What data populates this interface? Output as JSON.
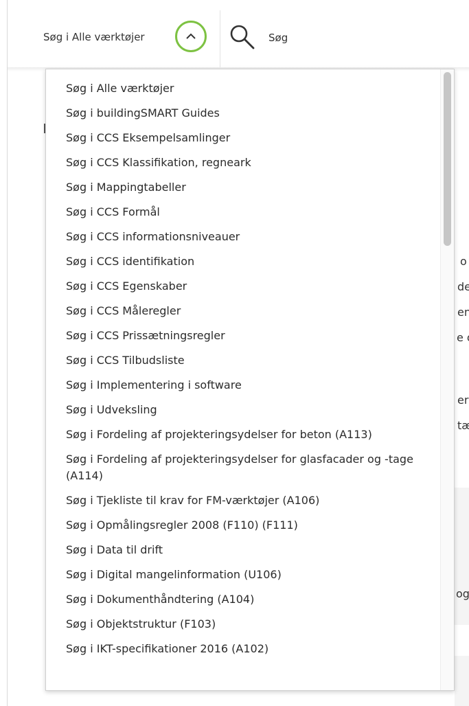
{
  "header": {
    "scope_label": "Søg i Alle værktøjer",
    "search_label": "Søg",
    "accent_color": "#7dc242"
  },
  "background": {
    "fragments": [
      "o",
      "de",
      "en",
      "e o",
      "er",
      "tæ",
      "og"
    ]
  },
  "dropdown": {
    "items": [
      "Søg i Alle værktøjer",
      "Søg i buildingSMART Guides",
      "Søg i CCS Eksempelsamlinger",
      "Søg i CCS Klassifikation, regneark",
      "Søg i Mappingtabeller",
      "Søg i CCS Formål",
      "Søg i CCS informationsniveauer",
      "Søg i CCS identifikation",
      "Søg i CCS Egenskaber",
      "Søg i CCS Måleregler",
      "Søg i CCS Prissætningsregler",
      "Søg i CCS Tilbudsliste",
      "Søg i Implementering i software",
      "Søg i Udveksling",
      "Søg i Fordeling af projekteringsydelser for beton (A113)",
      "Søg i Fordeling af projekteringsydelser for glasfacader og -tage (A114)",
      "Søg i Tjekliste til krav for FM-værktøjer (A106)",
      "Søg i Opmålingsregler 2008 (F110) (F111)",
      "Søg i Data til drift",
      "Søg i Digital mangelinformation (U106)",
      "Søg i Dokumenthåndtering (A104)",
      "Søg i Objektstruktur (F103)",
      "Søg i IKT-specifikationer 2016 (A102)"
    ]
  }
}
